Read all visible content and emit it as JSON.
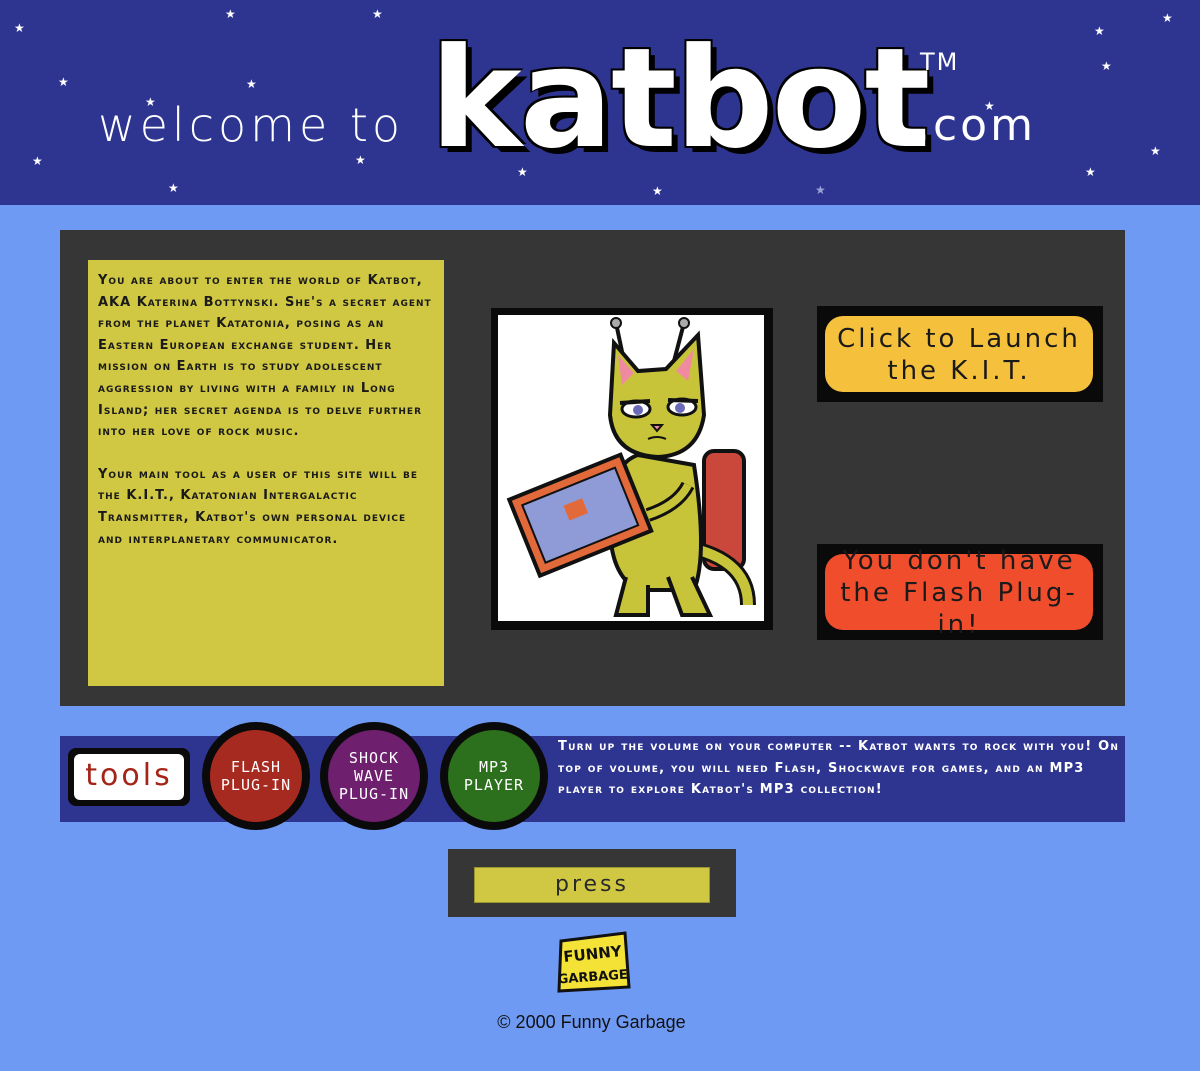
{
  "header": {
    "welcome": "welcome to",
    "logo": "katbot",
    "trademark": "TM",
    "domain_suffix": ".com"
  },
  "intro": {
    "paragraph1": "You are about to enter the world of Katbot, AKA Katerina Bottynski. She's a secret agent from the planet Katatonia, posing as an Eastern European exchange student. Her mission on Earth is to study adolescent aggression by living with a family in Long Island; her secret agenda is to delve further into her love of rock music.",
    "paragraph2": "Your main tool as a user of this site will be the K.I.T., Katatonian Intergalactic Transmitter, Katbot's own personal device and interplanetary communicator."
  },
  "buttons": {
    "launch_line1": "Click to Launch",
    "launch_line2": "the K.I.T.",
    "flash_line1": "You don't have",
    "flash_line2": "the Flash Plug-in!"
  },
  "tools": {
    "label": "tools",
    "flash_line1": "FLASH",
    "flash_line2": "PLUG-IN",
    "shock_line1": "SHOCK",
    "shock_line2": "WAVE",
    "shock_line3": "PLUG-IN",
    "mp3_line1": "MP3",
    "mp3_line2": "PLAYER",
    "volume_text": "Turn up the volume on your computer -- Katbot wants to rock with you! On top of volume, you will need Flash, Shockwave for games, and an MP3 player to explore Katbot's MP3 collection!"
  },
  "press": {
    "label": "press"
  },
  "footer": {
    "logo_text": "FUNNY GARBAGE",
    "copyright": "© 2000 Funny Garbage"
  },
  "colors": {
    "header_bg": "#2e3590",
    "page_bg": "#6f9af4",
    "panel_bg": "#363636",
    "intro_bg": "#d0c842",
    "launch_bg": "#f5c13c",
    "flash_warning_bg": "#ef4d2c",
    "flash_circle": "#a72a20",
    "shock_circle": "#6e1f6e",
    "mp3_circle": "#2c6f1c"
  }
}
